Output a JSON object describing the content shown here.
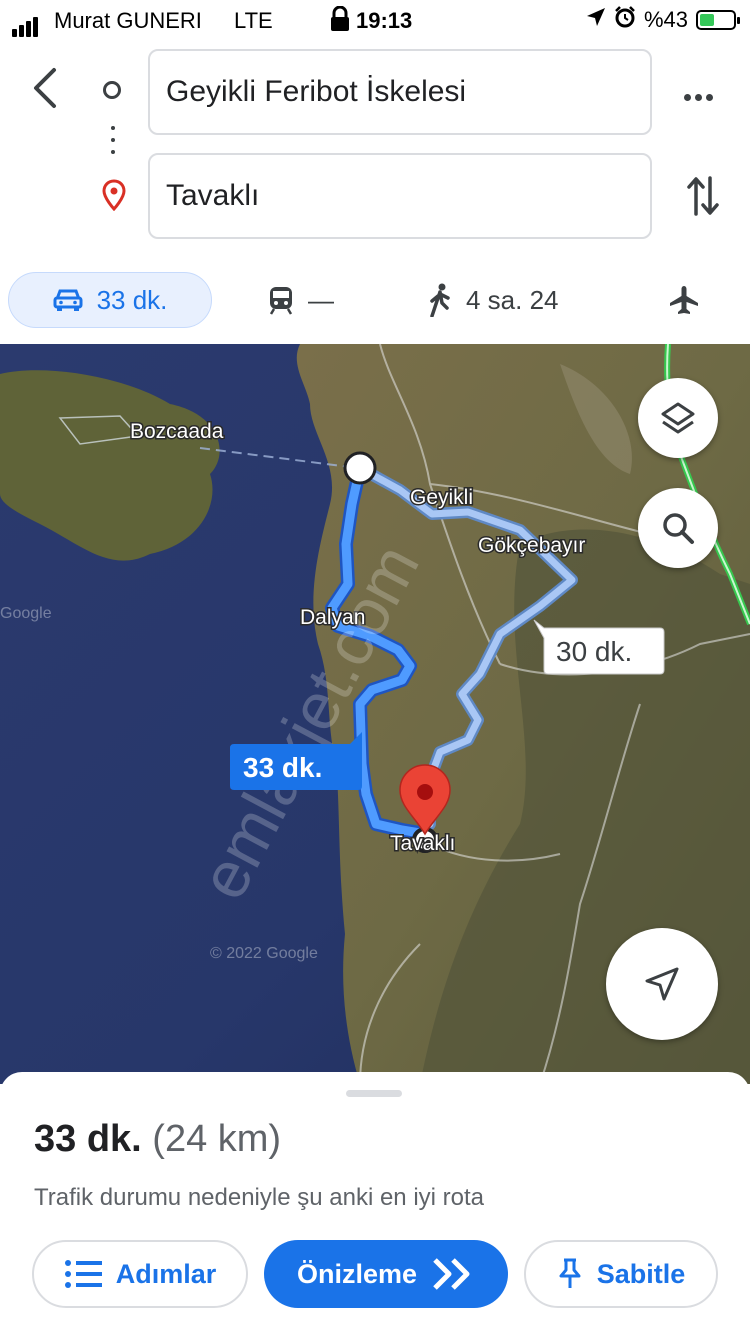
{
  "status_bar": {
    "carrier": "Murat GUNERI",
    "network": "LTE",
    "time": "19:13",
    "battery": "%43"
  },
  "search": {
    "origin": "Geyikli Feribot İskelesi",
    "destination": "Tavaklı"
  },
  "modes": {
    "drive": "33 dk.",
    "transit": "—",
    "walk": "4 sa. 24"
  },
  "map": {
    "labels": {
      "bozcaada": "Bozcaada",
      "geyikli": "Geyikli",
      "gokcebayir": "Gökçebayır",
      "dalyan": "Dalyan",
      "tavakli": "Tavaklı",
      "google": "Google",
      "copyright": "© 2022 Google"
    },
    "route_labels": {
      "alt": "30 dk.",
      "main": "33 dk."
    },
    "watermark": "emlakjet.com"
  },
  "sheet": {
    "duration": "33 dk.",
    "distance": "(24 km)",
    "note": "Trafik durumu nedeniyle şu anki en iyi rota",
    "buttons": {
      "steps": "Adımlar",
      "preview": "Önizleme",
      "pin": "Sabitle"
    }
  },
  "colors": {
    "accent": "#1a73e8",
    "route": "#4285f4",
    "alt_route": "#a9c7f5",
    "pin": "#ea4335"
  }
}
